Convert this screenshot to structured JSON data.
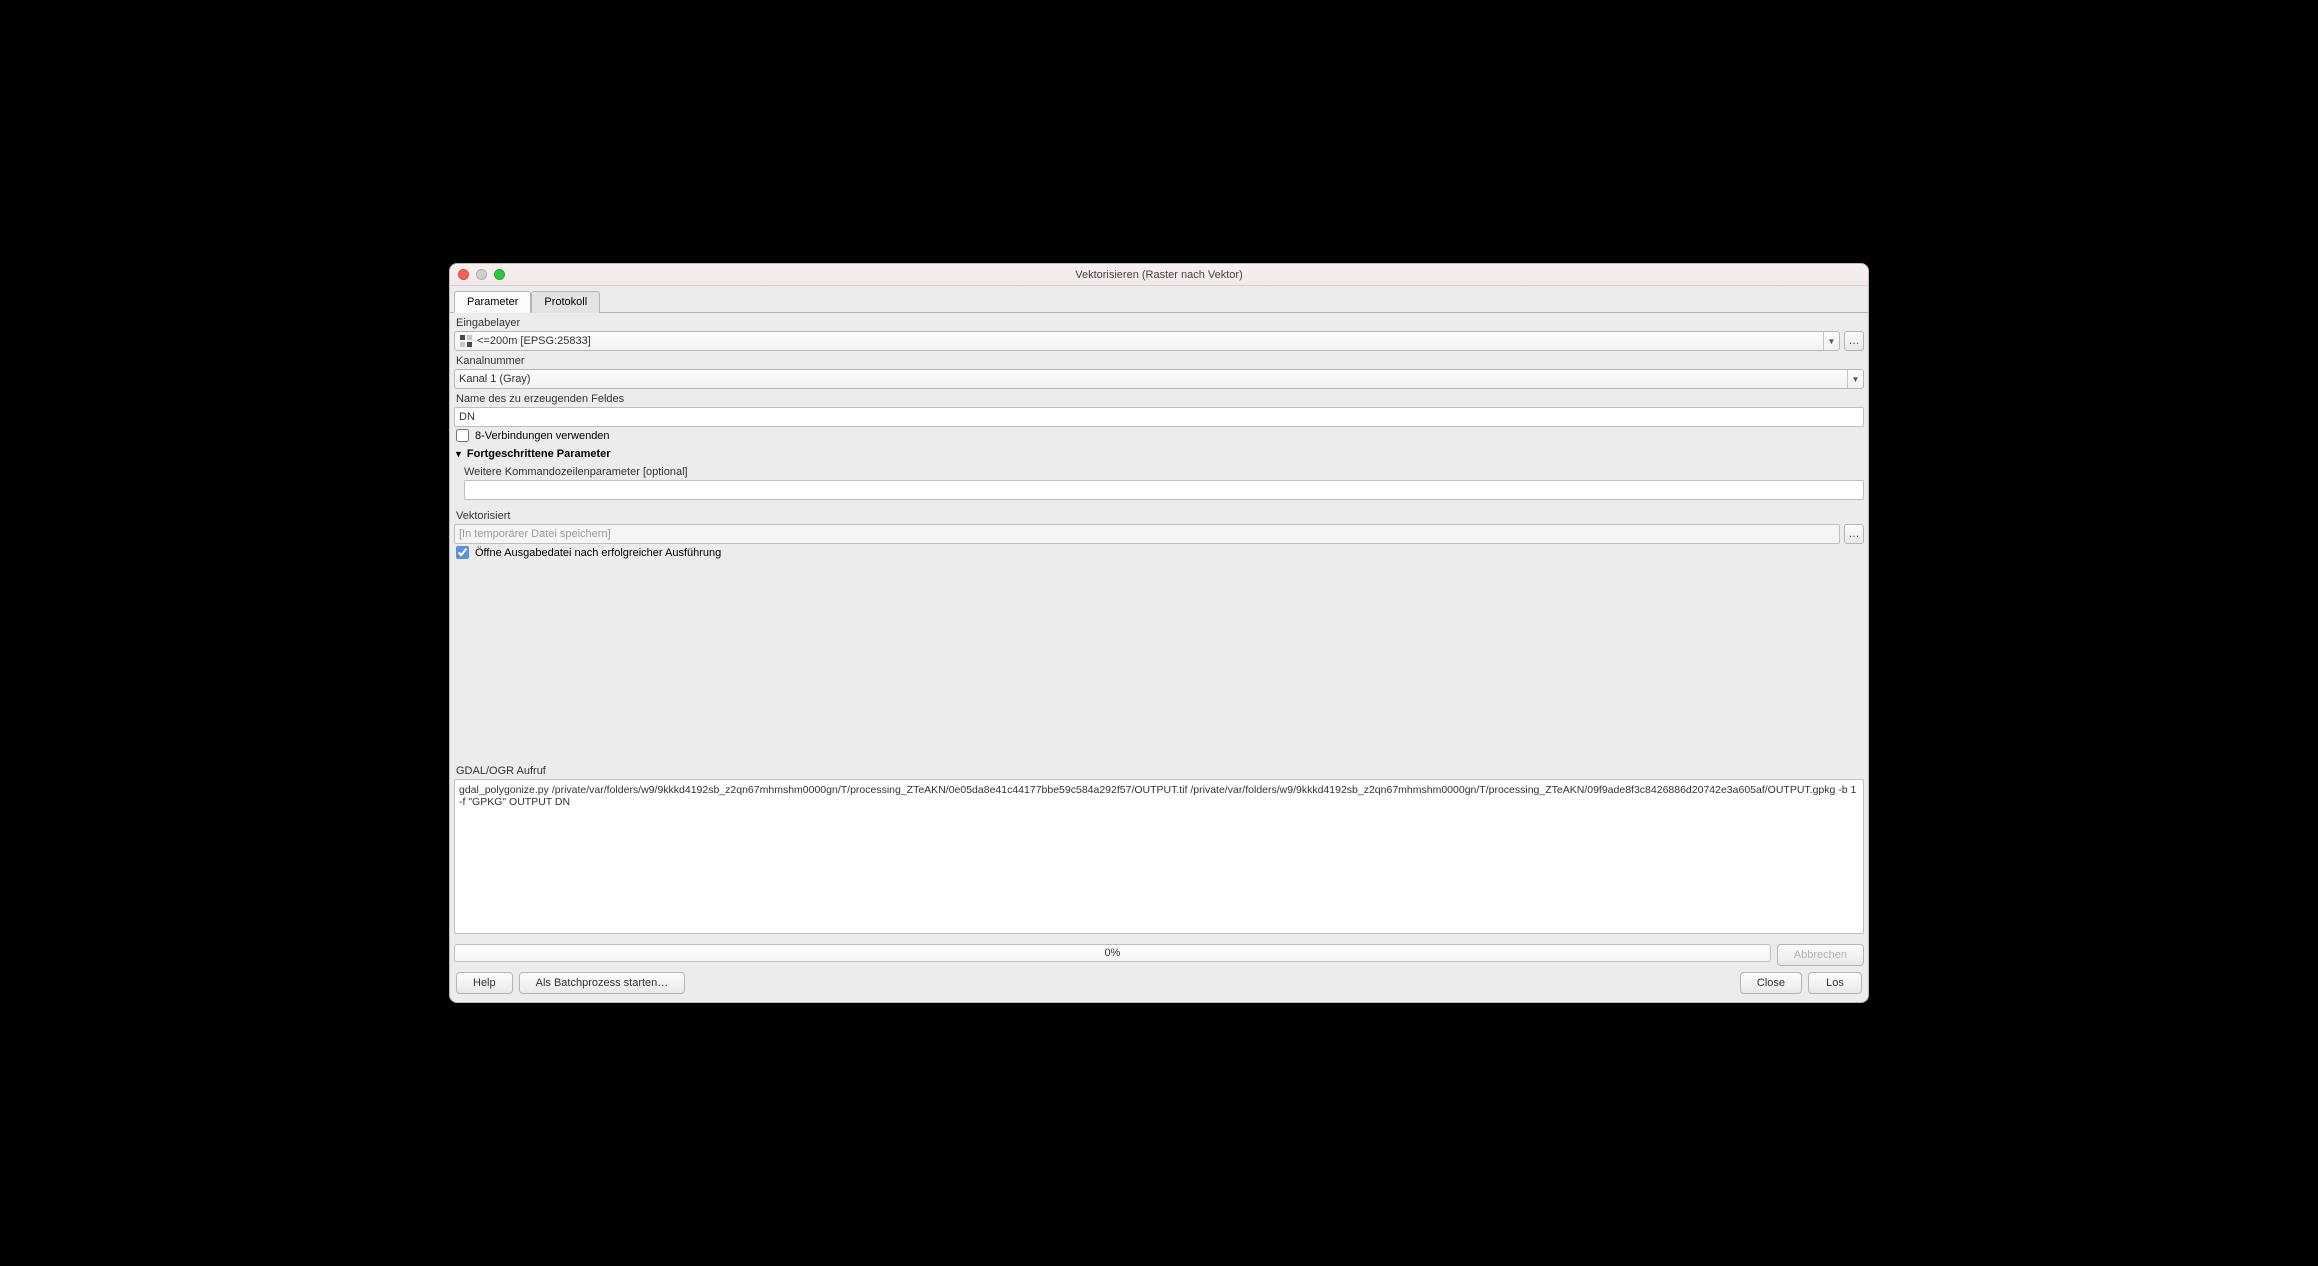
{
  "title": "Vektorisieren (Raster nach Vektor)",
  "tabs": {
    "parameter": "Parameter",
    "protokoll": "Protokoll"
  },
  "labels": {
    "eingabelayer": "Eingabelayer",
    "kanalnummer": "Kanalnummer",
    "feldname": "Name des zu erzeugenden Feldes",
    "acht": "8-Verbindungen verwenden",
    "advanced": "Fortgeschrittene Parameter",
    "cmdline": "Weitere Kommandozeilenparameter [optional]",
    "vektorisiert": "Vektorisiert",
    "openout": "Öffne Ausgabedatei nach erfolgreicher Ausführung",
    "gdal": "GDAL/OGR Aufruf"
  },
  "values": {
    "layer": "<=200m [EPSG:25833]",
    "band": "Kanal 1 (Gray)",
    "fieldname": "DN",
    "cmdline": "",
    "output_placeholder": "[In temporärer Datei speichern]",
    "gdal_call": "gdal_polygonize.py /private/var/folders/w9/9kkkd4192sb_z2qn67mhmshm0000gn/T/processing_ZTeAKN/0e05da8e41c44177bbe59c584a292f57/OUTPUT.tif /private/var/folders/w9/9kkkd4192sb_z2qn67mhmshm0000gn/T/processing_ZTeAKN/09f9ade8f3c8426886d20742e3a605af/OUTPUT.gpkg -b 1 -f \"GPKG\" OUTPUT DN"
  },
  "progress": "0%",
  "buttons": {
    "abbrechen": "Abbrechen",
    "help": "Help",
    "batch": "Als Batchprozess starten…",
    "close": "Close",
    "los": "Los",
    "dots": "…"
  }
}
